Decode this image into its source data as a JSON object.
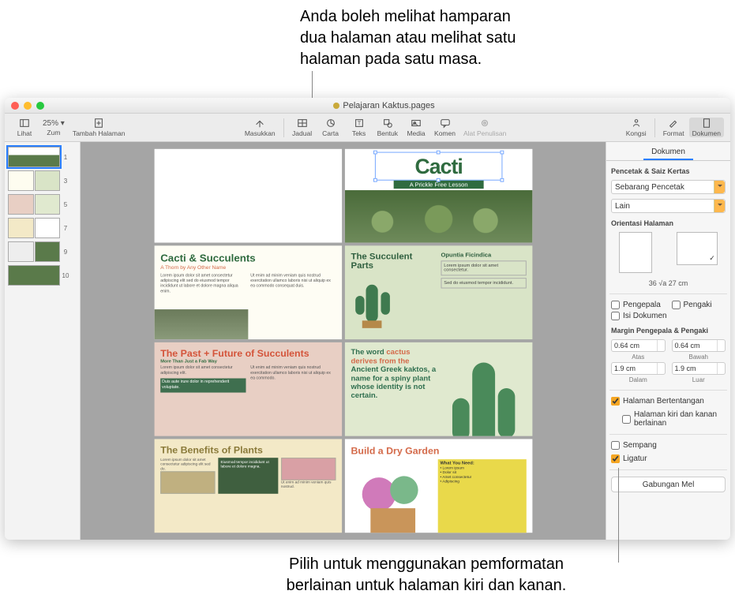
{
  "callouts": {
    "top": "Anda boleh melihat hamparan\ndua halaman atau melihat satu\nhalaman pada satu masa.",
    "bottom": "Pilih untuk menggunakan pemformatan\nberlainan untuk halaman kiri dan kanan."
  },
  "window": {
    "title": "Pelajaran Kaktus.pages"
  },
  "toolbar": {
    "lihat": "Lihat",
    "zum": "Zum",
    "zum_value": "25% ▾",
    "tambah": "Tambah Halaman",
    "masukkan": "Masukkan",
    "jadual": "Jadual",
    "carta": "Carta",
    "teks": "Teks",
    "bentuk": "Bentuk",
    "media": "Media",
    "komen": "Komen",
    "alat": "Alat Penulisan",
    "kongsi": "Kongsi",
    "format": "Format",
    "dokumen": "Dokumen"
  },
  "thumbs": {
    "p1": "1",
    "p3": "3",
    "p5": "5",
    "p7": "7",
    "p9": "9",
    "p10": "10"
  },
  "pages": {
    "cover_title": "Cacti",
    "cover_sub": "A Prickle Free Lesson",
    "p2_h": "Cacti & Succulents",
    "p2_s": "A Thorn by Any Other Name",
    "p3_h": "The Succulent Parts",
    "p3_r": "Opuntia Ficindica",
    "p4_h": "The Past + Future of Succulents",
    "p4_s": "More Than Just a Fab Way",
    "p5_t1": "The word",
    "p5_t2": "cactus derives from the",
    "p5_t3": "Ancient Greek kaktos,",
    "p5_t4": "a name for a spiny plant whose identity is not certain.",
    "p6_h": "The Benefits of Plants",
    "p7_h": "Build a Dry Garden",
    "p7_card": "What You Need:"
  },
  "inspector": {
    "tab_doc": "Dokumen",
    "section_printer": "Pencetak & Saiz Kertas",
    "printer_sel": "Sebarang Pencetak",
    "paper_sel": "Lain",
    "section_orient": "Orientasi Halaman",
    "dims": "36 √a 27 cm",
    "chk_header": "Pengepala",
    "chk_footer": "Pengaki",
    "chk_body": "Isi Dokumen",
    "section_margins": "Margin Pengepala & Pengaki",
    "m_top_v": "0.64 cm",
    "m_top_l": "Atas",
    "m_bot_v": "0.64 cm",
    "m_bot_l": "Bawah",
    "m_in_v": "1.9 cm",
    "m_in_l": "Dalam",
    "m_out_v": "1.9 cm",
    "m_out_l": "Luar",
    "chk_facing": "Halaman Bertentangan",
    "chk_leftright": "Halaman kiri dan kanan berlainan",
    "chk_hyphen": "Sempang",
    "chk_lig": "Ligatur",
    "mailmerge": "Gabungan Mel"
  }
}
